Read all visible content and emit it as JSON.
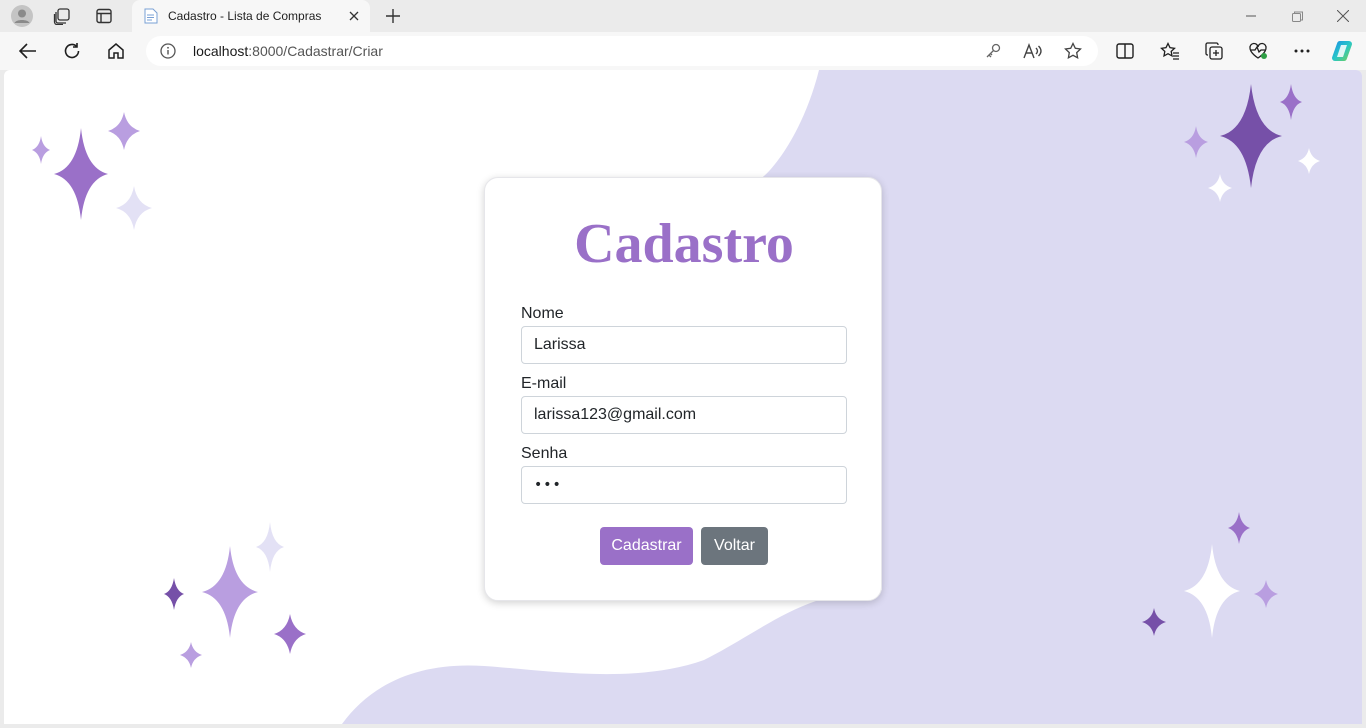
{
  "browser": {
    "tab_title": "Cadastro - Lista de Compras",
    "url_host": "localhost",
    "url_rest": ":8000/Cadastrar/Criar"
  },
  "icons": {
    "profile": "profile-avatar-icon",
    "workspaces": "workspaces-icon",
    "tab_actions": "tab-actions-icon",
    "favicon": "page-favicon-icon",
    "close_tab": "close-icon",
    "new_tab": "plus-icon",
    "back": "back-arrow-icon",
    "refresh": "refresh-icon",
    "home": "home-icon",
    "info": "info-icon",
    "password_key": "key-icon",
    "read_aloud": "read-aloud-icon",
    "favorite": "star-icon",
    "split": "split-screen-icon",
    "favorites": "favorites-icon",
    "collections": "collections-icon",
    "performance": "heartbeat-icon",
    "more": "more-icon",
    "copilot": "copilot-icon"
  },
  "form": {
    "title": "Cadastro",
    "fields": [
      {
        "label": "Nome",
        "value": "Larissa"
      },
      {
        "label": "E-mail",
        "value": "larissa123@gmail.com"
      },
      {
        "label": "Senha",
        "value": "•••"
      }
    ],
    "submit_label": "Cadastrar",
    "back_label": "Voltar"
  },
  "colors": {
    "accent": "#9a70c8",
    "secondary_button": "#6c757d",
    "wave": "#dcdaf2",
    "sparkle_dark": "#7650a8",
    "sparkle_mid": "#9a70c8",
    "sparkle_light": "#b99ee0",
    "sparkle_pale": "#e3e1f5"
  }
}
